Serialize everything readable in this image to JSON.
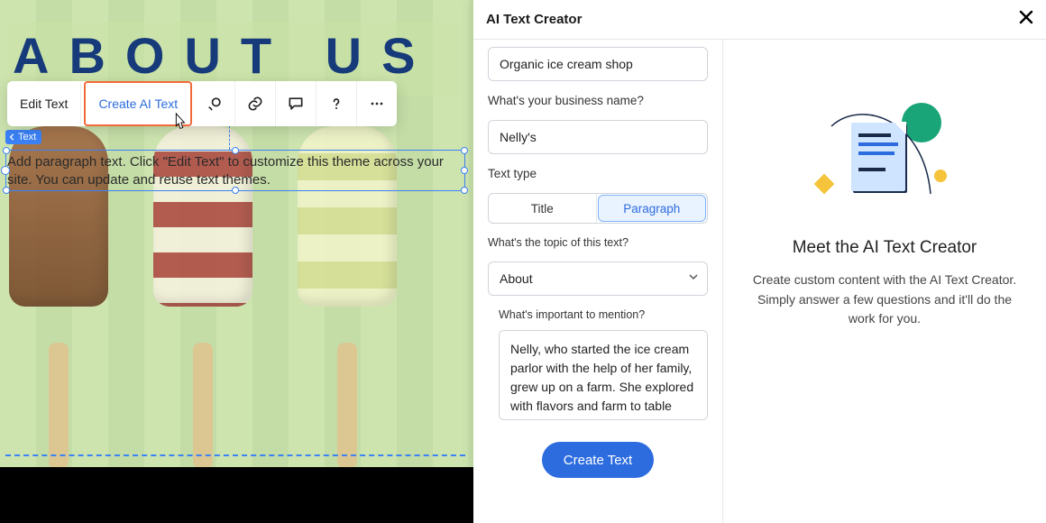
{
  "canvas": {
    "heading": "ABOUT US",
    "selection_label": "Text",
    "paragraph": "Add paragraph text. Click \"Edit Text\" to customize this theme across your site. You can update and reuse text themes."
  },
  "toolbar": {
    "edit_text": "Edit Text",
    "create_ai_text": "Create AI Text",
    "icons": {
      "animation": "animation-icon",
      "link": "link-icon",
      "comment": "comment-icon",
      "help": "help-icon",
      "more": "more-icon"
    }
  },
  "panel": {
    "title": "AI Text Creator",
    "form": {
      "business_desc_value": "Organic ice cream shop",
      "business_name_label": "What's your business name?",
      "business_name_value": "Nelly's",
      "text_type_label": "Text type",
      "text_type_options": {
        "title": "Title",
        "paragraph": "Paragraph"
      },
      "topic_label": "What's the topic of this text?",
      "topic_value": "About",
      "important_label": "What's important to mention?",
      "important_value": "Nelly, who started the ice cream parlor with the help of her family, grew up on a farm. She explored with flavors and farm to table",
      "create_button": "Create Text"
    },
    "info": {
      "title": "Meet the AI Text Creator",
      "description": "Create custom content with the AI Text Creator. Simply answer a few questions and it'll do the work for you."
    }
  }
}
